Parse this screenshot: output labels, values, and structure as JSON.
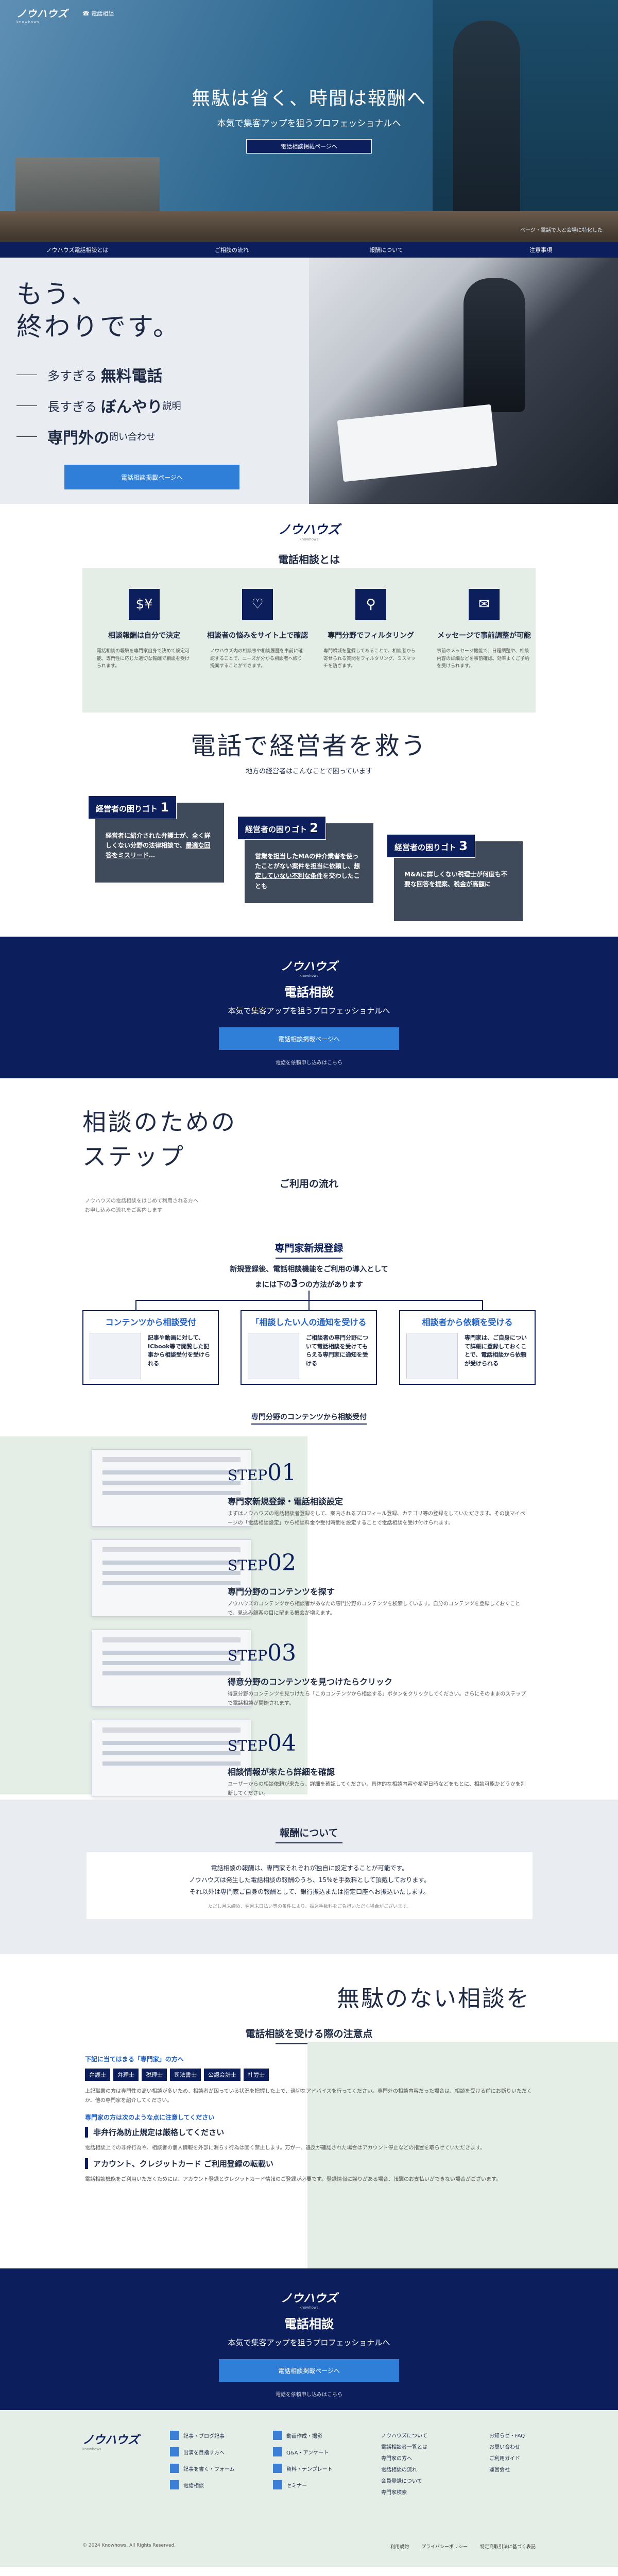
{
  "header": {
    "logo": "ノウハウズ",
    "logo_sub": "knowhows",
    "service_name": "電話相談"
  },
  "hero": {
    "title": "無駄は省く、時間は報酬へ",
    "tagline": "本気で集客アップを狙うプロフェッショナルへ",
    "button": "電話相談掲載ページへ",
    "caption": "ページ・電話で人と会場に特化した"
  },
  "nav": [
    "ノウハウズ電話相談とは",
    "ご相談の流れ",
    "報酬について",
    "注意事項"
  ],
  "nomore": {
    "title_line1": "もう、",
    "title_line2": "終わりです。",
    "items": [
      {
        "pre": "多すぎる",
        "em": "無料電話",
        "post": ""
      },
      {
        "pre": "長すぎる",
        "em": "ぼんやり",
        "post": "説明"
      },
      {
        "pre": "",
        "em": "専門外の",
        "post": "問い合わせ"
      }
    ],
    "button": "電話相談掲載ページへ"
  },
  "about": {
    "logo": "ノウハウズ",
    "logo_sub": "knowhows",
    "title": "電話相談とは",
    "cards": [
      {
        "icon": "$¥",
        "title": "相談報酬は自分で決定",
        "text": "電話相談の報酬を専門家自身で決めて設定可能。専門性に応じた適切な報酬で相談を受けられます。"
      },
      {
        "icon": "♡",
        "title": "相談者の悩みをサイト上で確認",
        "text": "ノウハウズ内の相談事や相談履歴を事前に確認することで、ニーズが分かる相談者へ絞り提案することができます。"
      },
      {
        "icon": "⚲",
        "title": "専門分野でフィルタリング",
        "text": "専門領域を登録してあることで、相談者から寄せられる質問をフィルタリング、ミスマッチを防ぎます。"
      },
      {
        "icon": "✉",
        "title": "メッセージで事前調整が可能",
        "text": "事前のメッセージ機能で、日程調整や、相談内容の詳細などを事前確認。効率よくご予約を受けられます。"
      }
    ]
  },
  "pain": {
    "title": "電話で経営者を救う",
    "subtitle": "地方の経営者はこんなことで困っています",
    "cards": [
      {
        "label": "経営者の困りゴト",
        "num": "1",
        "text_a": "経営者に紹介された弁護士が、全く詳しくない分野の法律相談で、",
        "text_u": "最適な回答をミスリード",
        "text_b": "…"
      },
      {
        "label": "経営者の困りゴト",
        "num": "2",
        "text_a": "営業を担当したMAの仲介業者を使ったことがない案件を担当に依頼し、",
        "text_u": "想定していない不利な条件",
        "text_b": "を交わしたことも"
      },
      {
        "label": "経営者の困りゴト",
        "num": "3",
        "text_a": "M&Aに詳しくない税理士が何度も不要な回答を提案、",
        "text_u": "税金が高額",
        "text_b": "に"
      }
    ]
  },
  "cta1": {
    "logo": "ノウハウズ",
    "logo_sub": "knowhows",
    "title": "電話相談",
    "tagline": "本気で集客アップを狙うプロフェッショナルへ",
    "button": "電話相談掲載ページへ",
    "note": "電話を依頼申し込みはこちら"
  },
  "steps": {
    "title_line1": "相談のための",
    "title_line2": "ステップ",
    "flow_title": "ご利用の流れ",
    "intro_line1": "ノウハウズの電話相談をはじめて利用される方へ",
    "intro_line2": "お申し込みの流れをご案内します",
    "register_title": "専門家新規登録",
    "register_desc_line1": "新規登録後、電話相談機能をご利用の導入として",
    "register_desc_line2_pre": "まには下の",
    "register_desc_num": "3",
    "register_desc_line2_post": "つの方法があります",
    "ways": [
      {
        "title": "コンテンツから相談受付",
        "text": "記事や動画に対して、ICbook等で閲覧した記事から相談受付を受けられる"
      },
      {
        "title": "「相談したい人の通知を受ける",
        "text": "ご相談者の専門分野について電話相談を受けてもらえる専門家に通知を受ける"
      },
      {
        "title": "相談者から依頼を受ける",
        "text": "専門家は、ご自身について詳細に登録しておくことで、電話相談から依頼が受けられる"
      }
    ],
    "bar": "専門分野のコンテンツから相談受付",
    "items": [
      {
        "step": "STEP",
        "num": "01",
        "title": "専門家新規登録・電話相談設定",
        "desc": "まずはノウハウズの電話相談者登録をして、案内されるプロフィール登録、カテゴリ等の登録をしていただきます。その後マイページの「電話相談設定」から相談料金や受付時間を設定することで電話相談を受け付けられます。"
      },
      {
        "step": "STEP",
        "num": "02",
        "title": "専門分野のコンテンツを探す",
        "desc": "ノウハウズのコンテンツから相談者があなたの専門分野のコンテンツを検索しています。自分のコンテンツを登録しておくことで、見込み顧客の目に留まる機会が増えます。"
      },
      {
        "step": "STEP",
        "num": "03",
        "title": "得意分野のコンテンツを見つけたらクリック",
        "desc": "得意分野のコンテンツを見つけたら「このコンテンツから相談する」ボタンをクリックしてください。さらにそのままのステップで電話相談が開始されます。"
      },
      {
        "step": "STEP",
        "num": "04",
        "title": "相談情報が来たら詳細を確認",
        "desc": "ユーザーからの相談依頼が来たら、詳細を確認してください。具体的な相談内容や希望日時などをもとに、相談可能かどうかを判断してください。"
      }
    ]
  },
  "report": {
    "title": "報酬について",
    "line1": "電話相談の報酬は、専門家それぞれが独自に設定することが可能です。",
    "line2": "ノウハウズは発生した電話相談の報酬のうち、15%を手数料として頂戴しております。",
    "line3": "それ以外は専門家ご自身の報酬として、銀行振込または指定口座へお振込いたします。",
    "note": "ただし月末締め、翌月末日払い等の条件により、振込手数料をご負担いただく場合がございます。"
  },
  "caution": {
    "title": "無駄のない相談を",
    "subtitle": "電話相談を受ける際の注意点",
    "label1": "下記に当てはまる「専門家」の方へ",
    "tags": [
      "弁護士",
      "弁理士",
      "税理士",
      "司法書士",
      "公認会計士",
      "社労士"
    ],
    "para1": "上記職業の方は専門性の高い相談が多いため、相談者が困っている状況を把握した上で、適切なアドバイスを行ってください。専門外の相談内容だった場合は、相談を受ける前にお断りいただくか、他の専門家を紹介してください。",
    "label2": "専門家の方は次のような点に注意してください",
    "h1": "非弁行為防止規定は厳格してください",
    "para2": "電話相談上での非弁行為や、相談者の個人情報を外部に漏らす行為は固く禁止します。万が一、違反が確認された場合はアカウント停止などの措置を取らせていただきます。",
    "h2": "アカウント、クレジットカード ご利用登録の転載い",
    "para3": "電話相談機能をご利用いただくためには、アカウント登録とクレジットカード情報のご登録が必要です。登録情報に誤りがある場合、報酬のお支払いができない場合がございます。"
  },
  "cta2": {
    "logo": "ノウハウズ",
    "logo_sub": "knowhows",
    "title": "電話相談",
    "tagline": "本気で集客アップを狙うプロフェッショナルへ",
    "button": "電話相談掲載ページへ",
    "note": "電話を依頼申し込みはこちら"
  },
  "footer": {
    "logo": "ノウハウズ",
    "logo_sub": "knowhows",
    "cats": [
      "記事・ブログ記事",
      "動画作成・撮影",
      "出演を目指す方へ",
      "Q&A・アンケート",
      "記事を書く・フォーム",
      "資料・テンプレート",
      "電話相談",
      "セミナー"
    ],
    "col1": [
      "ノウハウズについて",
      "電話相談者一覧とは",
      "専門家の方へ",
      "電話相談の流れ",
      "会員登録について",
      "専門家検索"
    ],
    "col2": [
      "お知らせ・FAQ",
      "お問い合わせ",
      "ご利用ガイド",
      "運営会社"
    ],
    "copy": "© 2024 Knowhows. All Rights Reserved.",
    "links": [
      "利用規約",
      "プライバシーポリシー",
      "特定商取引法に基づく表記"
    ]
  }
}
